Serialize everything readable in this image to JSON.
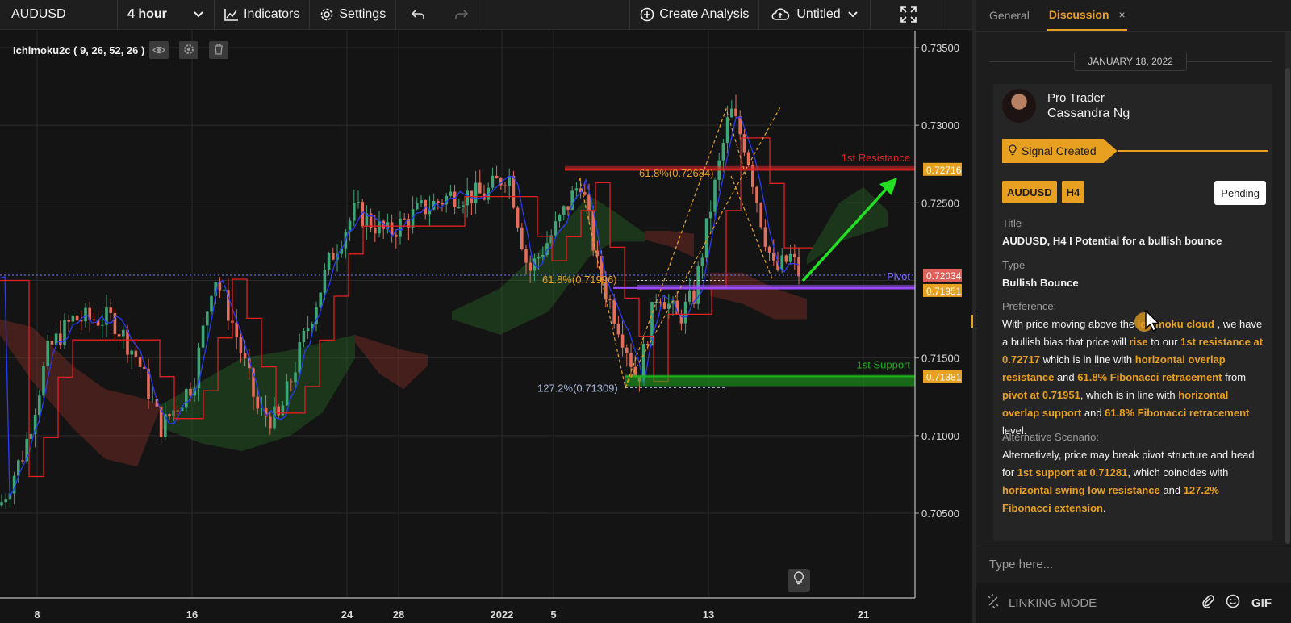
{
  "toolbar": {
    "symbol": "AUDUSD",
    "interval": "4 hour",
    "indicators_label": "Indicators",
    "settings_label": "Settings",
    "create_analysis_label": "Create Analysis",
    "untitled_label": "Untitled"
  },
  "indicator": {
    "legend": "Ichimoku2c ( 9, 26, 52, 26 )"
  },
  "chart": {
    "price_ticks": [
      "0.73500",
      "0.73000",
      "0.72500",
      "0.71500",
      "0.71000",
      "0.70500"
    ],
    "date_ticks": [
      "8",
      "16",
      "24",
      "28",
      "2022",
      "5",
      "13",
      "21"
    ],
    "labels": {
      "resistance": "1st Resistance",
      "pivot": "Pivot",
      "support": "1st Support",
      "fib_resistance": "61.8%(0.72684)",
      "fib_pivot": "61.8%(0.71996)",
      "fib_support": "127.2%(0.71309)"
    },
    "price_tags": {
      "resistance": "0.72716",
      "current": "0.72034",
      "pivot": "0.71951",
      "support": "0.71381"
    },
    "colors": {
      "up": "#3ea676",
      "down": "#e26d5a",
      "resistance": "#e02424",
      "pivot": "#9b4dff",
      "support": "#1fae1f",
      "accent": "#e8a020",
      "arrow": "#22e022"
    }
  },
  "panel": {
    "tabs": [
      "General",
      "Discussion"
    ],
    "close_icon": "×",
    "date": "JANUARY 18, 2022",
    "author_role": "Pro Trader",
    "author_name": "Cassandra Ng",
    "signal_label": "Signal Created",
    "badges": [
      "AUDUSD",
      "H4"
    ],
    "status": "Pending",
    "title_label": "Title",
    "title_value": "AUDUSD, H4 I Potential for a bullish bounce",
    "type_label": "Type",
    "type_value": "Bullish Bounce",
    "preference_label": "Preference:",
    "preference_segments": [
      {
        "t": "With price moving above the ",
        "h": false
      },
      {
        "t": "ichimoku cloud",
        "h": true
      },
      {
        "t": " , we have a bullish bias that price will ",
        "h": false
      },
      {
        "t": "rise",
        "h": true
      },
      {
        "t": " to our ",
        "h": false
      },
      {
        "t": "1st resistance at 0.72717",
        "h": true
      },
      {
        "t": " which is in line with ",
        "h": false
      },
      {
        "t": "horizontal overlap resistance",
        "h": true
      },
      {
        "t": " and ",
        "h": false
      },
      {
        "t": "61.8% Fibonacci retracement",
        "h": true
      },
      {
        "t": " from ",
        "h": false
      },
      {
        "t": "pivot at 0.71951",
        "h": true
      },
      {
        "t": ", which is in line with ",
        "h": false
      },
      {
        "t": "horizontal overlap support",
        "h": true
      },
      {
        "t": " and ",
        "h": false
      },
      {
        "t": "61.8% Fibonacci retracement",
        "h": true
      },
      {
        "t": " level.",
        "h": false
      }
    ],
    "alternative_label": "Alternative Scenario:",
    "alternative_segments": [
      {
        "t": "Alternatively, price may break pivot structure and head for ",
        "h": false
      },
      {
        "t": "1st support at 0.71281",
        "h": true
      },
      {
        "t": ", which coincides with ",
        "h": false
      },
      {
        "t": "horizontal swing low resistance",
        "h": true
      },
      {
        "t": " and ",
        "h": false
      },
      {
        "t": "127.2% Fibonacci extension",
        "h": true
      },
      {
        "t": ".",
        "h": false
      }
    ],
    "input_placeholder": "Type here...",
    "linking_mode": "LINKING MODE",
    "gif_label": "GIF"
  }
}
